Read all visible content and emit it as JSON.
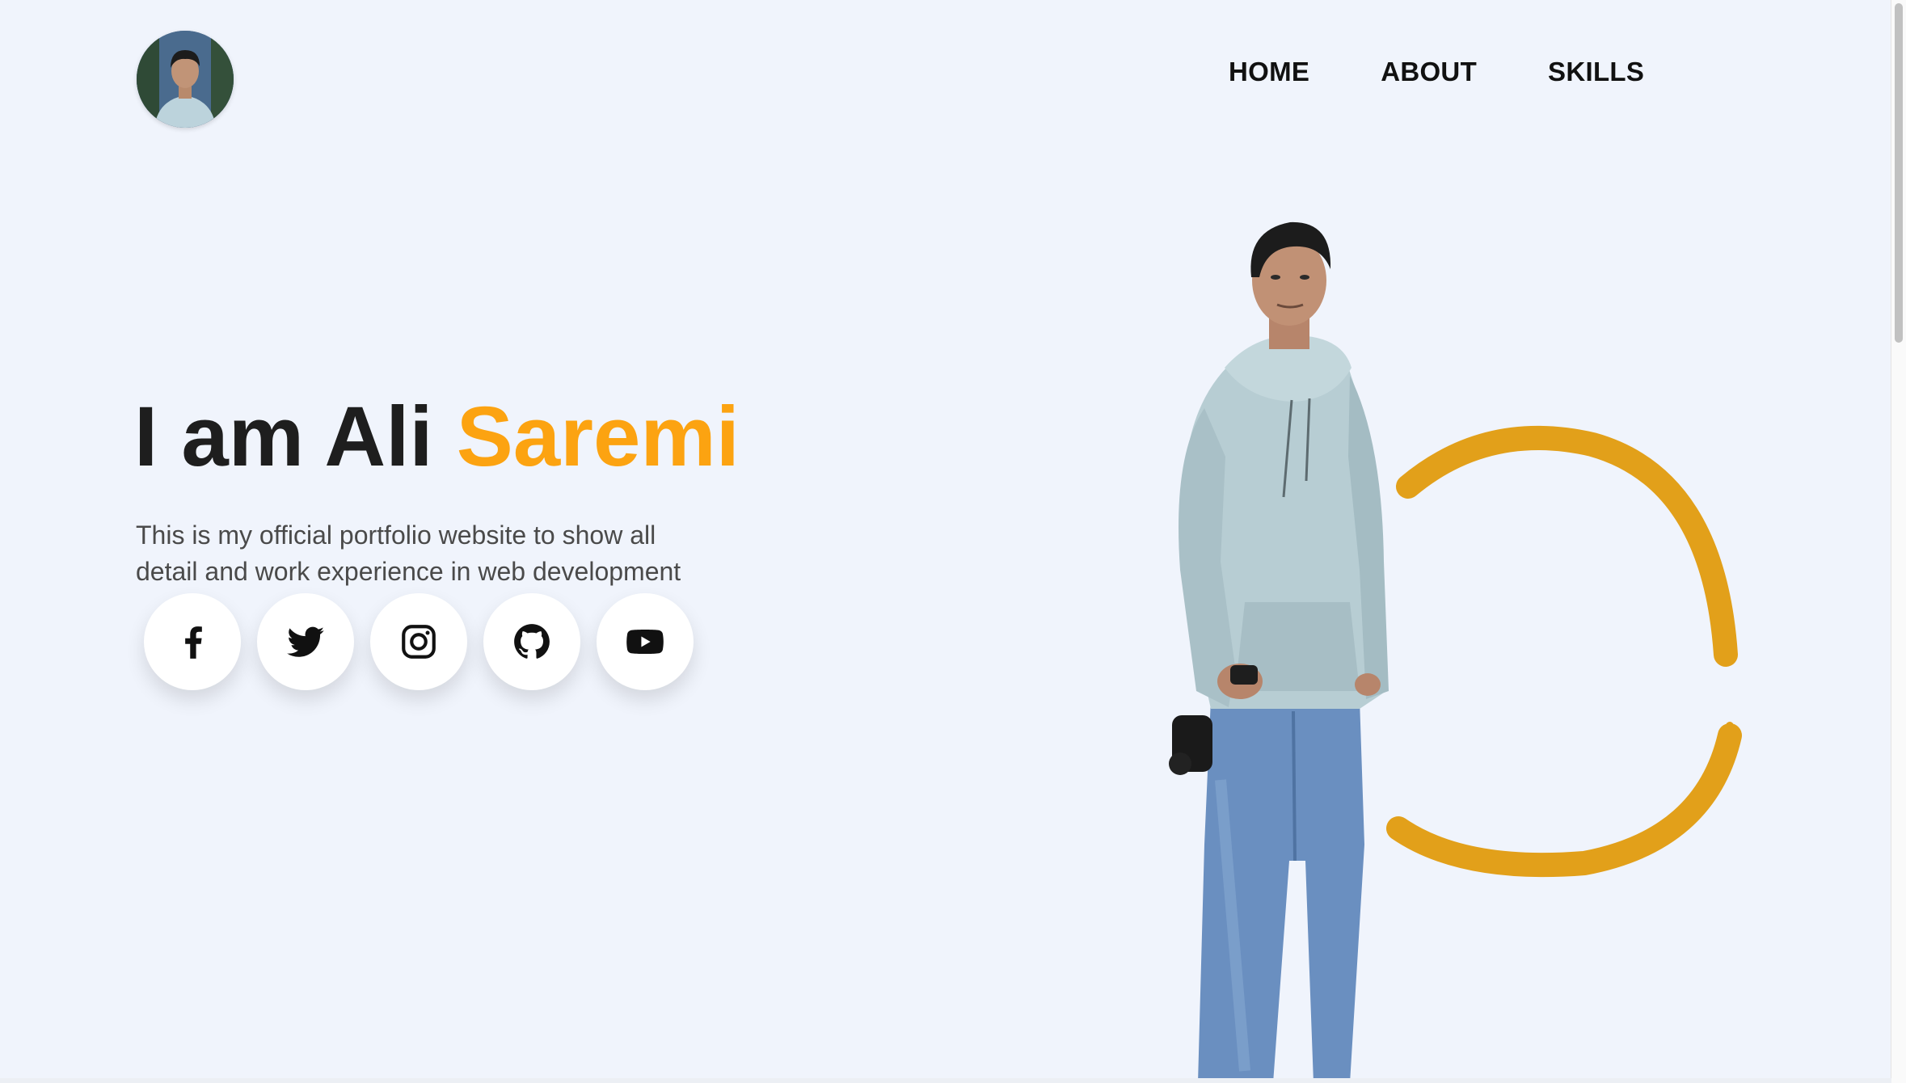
{
  "header": {
    "avatar_icon": "profile-photo-icon",
    "nav": [
      {
        "label": "HOME"
      },
      {
        "label": "ABOUT"
      },
      {
        "label": "SKILLS"
      }
    ]
  },
  "hero": {
    "title_prefix": "I am Ali ",
    "title_accent": "Saremi",
    "description": "This is my official portfolio website to show all detail and work experience in web development",
    "accent_color": "#fca311",
    "socials": [
      {
        "icon": "facebook-icon"
      },
      {
        "icon": "twitter-icon"
      },
      {
        "icon": "instagram-icon"
      },
      {
        "icon": "github-icon"
      },
      {
        "icon": "youtube-icon"
      }
    ]
  },
  "colors": {
    "background": "#f0f4fc",
    "accent": "#fca311",
    "ring": "#e2a01a",
    "text_dark": "#1e1e1e",
    "text_body": "#4a4a4a"
  }
}
